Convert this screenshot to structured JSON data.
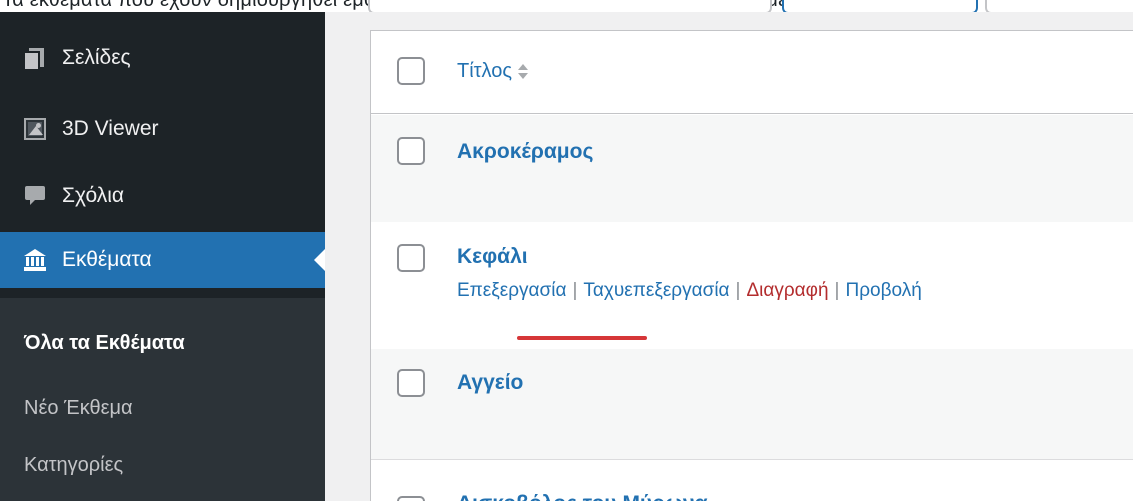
{
  "top": {
    "cropped_text": "Τα εκθέματα που έχουν δημιουργηθεί εμφανίζονται με τη μορφή λίστας σε αυτό το σημείο"
  },
  "sidebar": {
    "items": [
      {
        "label": "Σελίδες",
        "icon": "pages-icon"
      },
      {
        "label": "3D Viewer",
        "icon": "image-icon"
      },
      {
        "label": "Σχόλια",
        "icon": "comment-icon"
      },
      {
        "label": "Εκθέματα",
        "icon": "bank-icon",
        "active": true
      }
    ],
    "submenu": [
      {
        "label": "Όλα τα Εκθέματα",
        "current": true
      },
      {
        "label": "Νέο Έκθεμα"
      },
      {
        "label": "Κατηγορίες"
      }
    ],
    "colors": {
      "background": "#1d2327",
      "active": "#2271b1",
      "submenu_bg": "#2c3338"
    }
  },
  "table": {
    "column_title": "Τίτλος",
    "rows": [
      {
        "title": "Ακροκέραμος"
      },
      {
        "title": "Κεφάλι",
        "actions": [
          "Επεξεργασία",
          "Ταχυεπεξεργασία",
          "Διαγραφή",
          "Προβολή"
        ],
        "highlighted_action": "Διαγραφή"
      },
      {
        "title": "Αγγείο"
      },
      {
        "title": "Δισκοβόλος του Μύρωνα"
      }
    ],
    "colors": {
      "link": "#2271b1",
      "delete": "#b32d2e",
      "highlight_underline": "#d63638"
    }
  }
}
